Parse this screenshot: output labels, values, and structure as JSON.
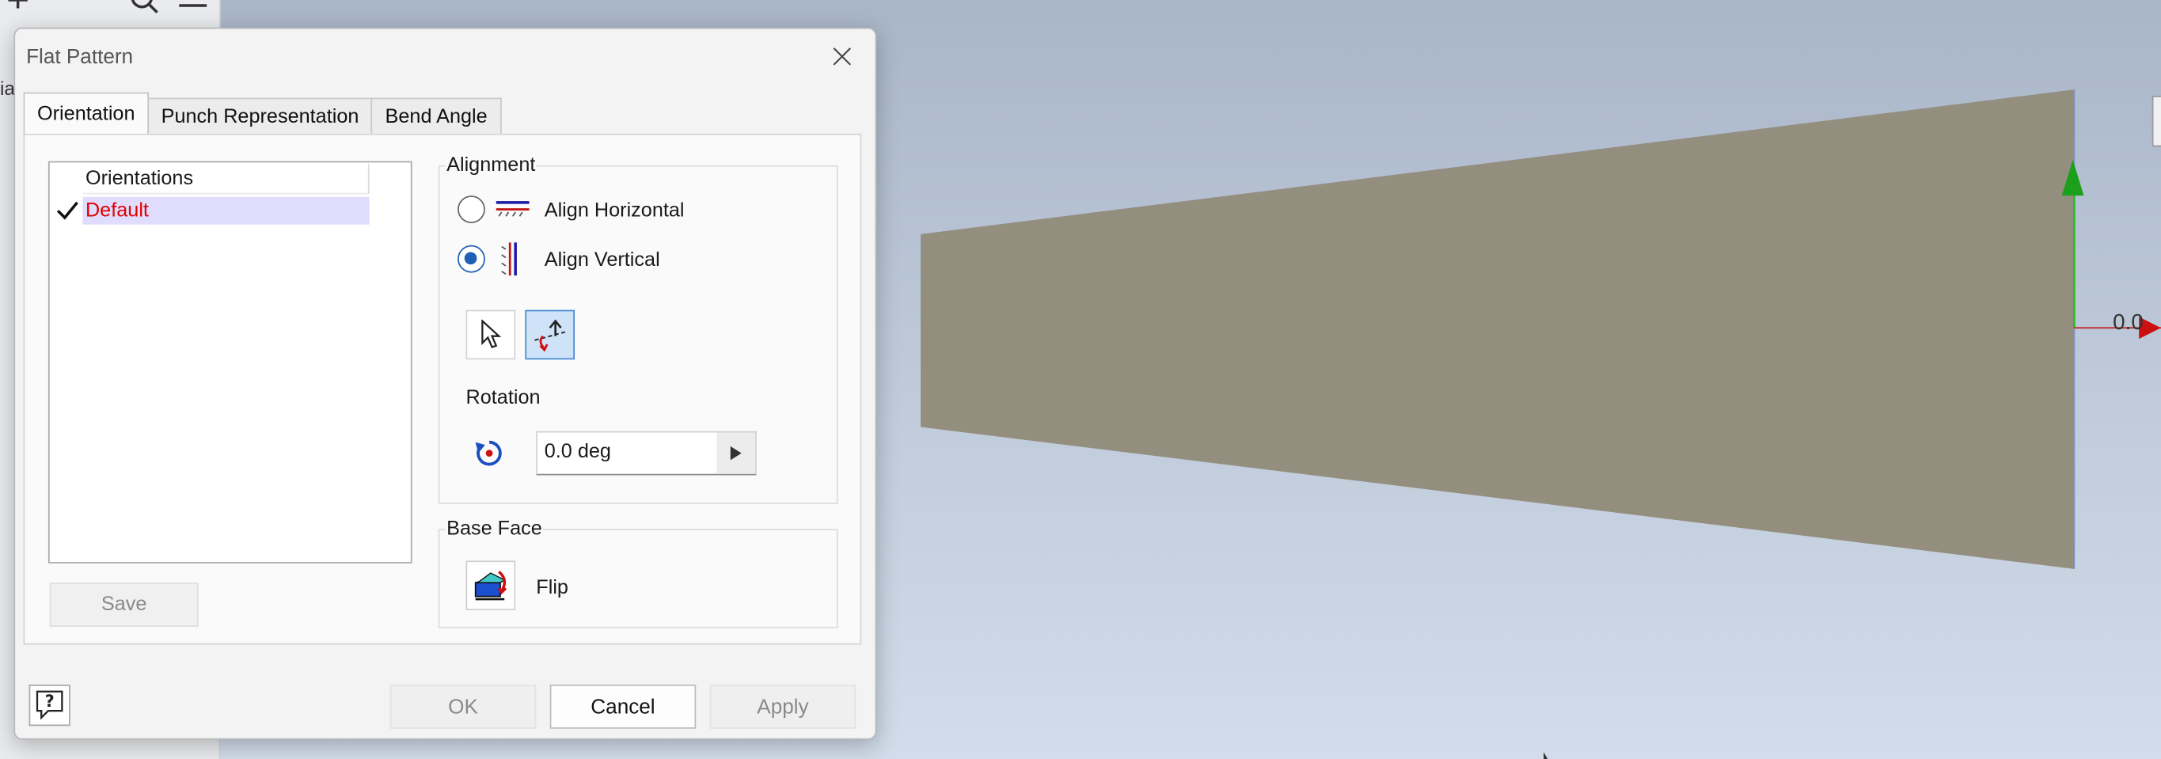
{
  "dialog": {
    "title": "Flat Pattern",
    "tabs": [
      "Orientation",
      "Punch Representation",
      "Bend Angle"
    ],
    "active_tab": "Orientation"
  },
  "orientation_list": {
    "header": "Orientations",
    "items": [
      {
        "label": "Default",
        "checked": true,
        "color": "#e00000"
      }
    ],
    "save_label": "Save"
  },
  "alignment": {
    "group_label": "Alignment",
    "options": [
      {
        "label": "Align Horizontal",
        "selected": false
      },
      {
        "label": "Align Vertical",
        "selected": true
      }
    ]
  },
  "rotation": {
    "label": "Rotation",
    "value": "0.0 deg"
  },
  "base_face": {
    "group_label": "Base Face",
    "flip_label": "Flip"
  },
  "buttons": {
    "ok": "OK",
    "cancel": "Cancel",
    "apply": "Apply"
  },
  "viewport": {
    "readout": "0.0",
    "sheet_color": "#948e7e",
    "axis_y_color": "#20c020",
    "axis_x_color": "#d01010"
  },
  "icons": [
    "close-icon",
    "align-horizontal-icon",
    "align-vertical-icon",
    "select-cursor-icon",
    "select-edge-icon",
    "rotate-icon",
    "spin-right-icon",
    "flip-face-icon",
    "help-icon",
    "search-icon",
    "menu-icon",
    "plus-icon"
  ]
}
